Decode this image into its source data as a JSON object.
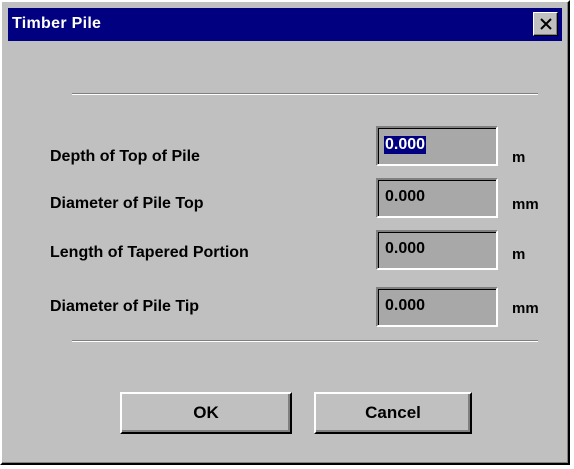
{
  "window": {
    "title": "Timber Pile",
    "close_icon": "close-icon"
  },
  "fields": [
    {
      "label": "Depth of Top of Pile",
      "value": "0.000",
      "unit": "m",
      "selected": true
    },
    {
      "label": "Diameter of Pile Top",
      "value": "0.000",
      "unit": "mm",
      "selected": false
    },
    {
      "label": "Length of Tapered Portion",
      "value": "0.000",
      "unit": "m",
      "selected": false
    },
    {
      "label": "Diameter of Pile Tip",
      "value": "0.000",
      "unit": "mm",
      "selected": false
    }
  ],
  "buttons": {
    "ok_label": "OK",
    "cancel_label": "Cancel"
  },
  "colors": {
    "titlebar": "#000080",
    "dialog_face": "#c0c0c0",
    "input_face": "#a8a8a8",
    "selection": "#000080"
  }
}
